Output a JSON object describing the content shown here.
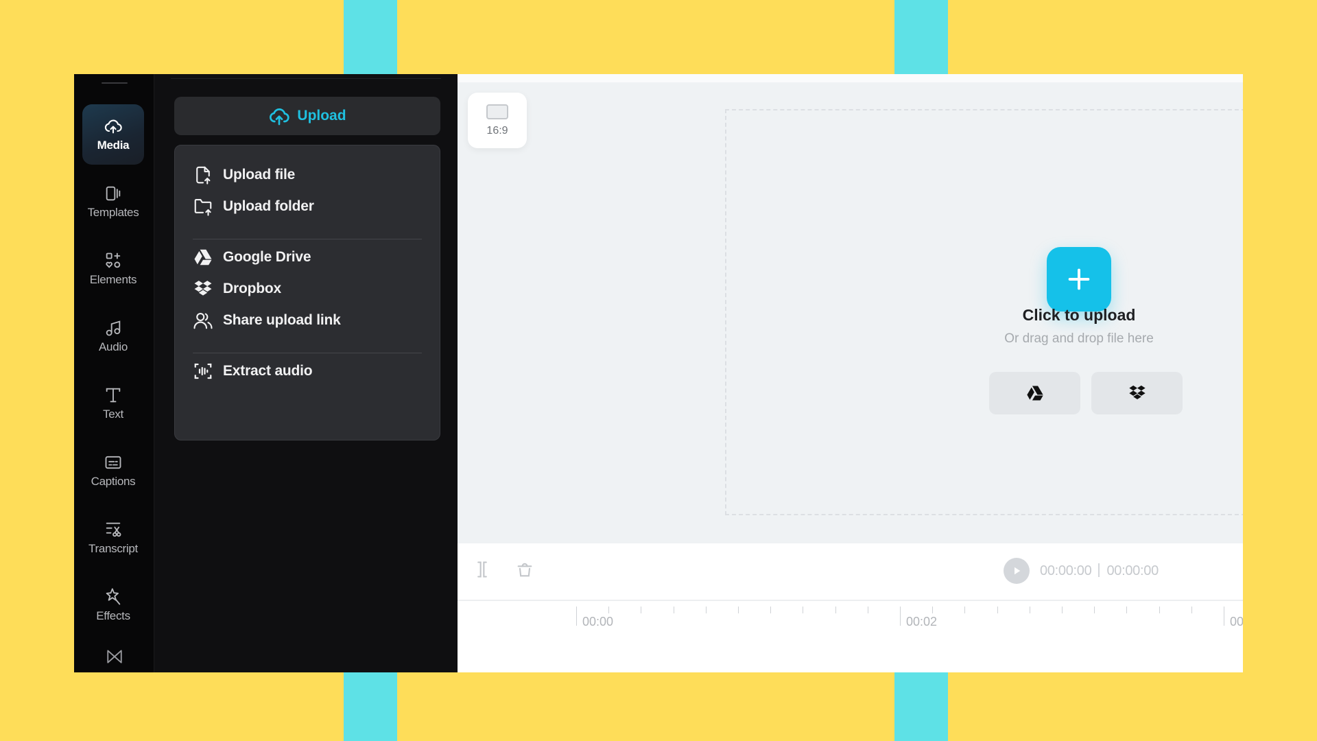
{
  "sidebar": {
    "items": [
      {
        "label": "Media",
        "icon": "cloud-upload-icon",
        "active": true
      },
      {
        "label": "Templates",
        "icon": "templates-icon",
        "active": false
      },
      {
        "label": "Elements",
        "icon": "elements-icon",
        "active": false
      },
      {
        "label": "Audio",
        "icon": "music-note-icon",
        "active": false
      },
      {
        "label": "Text",
        "icon": "text-icon",
        "active": false
      },
      {
        "label": "Captions",
        "icon": "captions-icon",
        "active": false
      },
      {
        "label": "Transcript",
        "icon": "transcript-icon",
        "active": false
      },
      {
        "label": "Effects",
        "icon": "effects-icon",
        "active": false
      }
    ],
    "more_icon": "transitions-icon"
  },
  "panel": {
    "upload_button": "Upload",
    "menu": {
      "items": [
        {
          "label": "Upload file",
          "icon": "file-upload-icon"
        },
        {
          "label": "Upload folder",
          "icon": "folder-upload-icon"
        },
        {
          "label": "Google Drive",
          "icon": "google-drive-icon"
        },
        {
          "label": "Dropbox",
          "icon": "dropbox-icon"
        },
        {
          "label": "Share upload link",
          "icon": "users-icon"
        },
        {
          "label": "Extract audio",
          "icon": "extract-audio-icon"
        }
      ]
    }
  },
  "canvas": {
    "aspect_ratio": "16:9",
    "dropzone": {
      "title": "Click to upload",
      "subtitle": "Or drag and drop file here",
      "buttons": [
        {
          "icon": "google-drive-icon"
        },
        {
          "icon": "dropbox-icon"
        }
      ]
    }
  },
  "timeline": {
    "current_time": "00:00:00",
    "total_time": "00:00:00",
    "ruler_labels": [
      "00:00",
      "00:02",
      "00"
    ]
  },
  "colors": {
    "accent": "#15c1e9",
    "upload_text": "#1fc0e0",
    "background": "#fedd59",
    "stripe": "#5ee1e6"
  }
}
